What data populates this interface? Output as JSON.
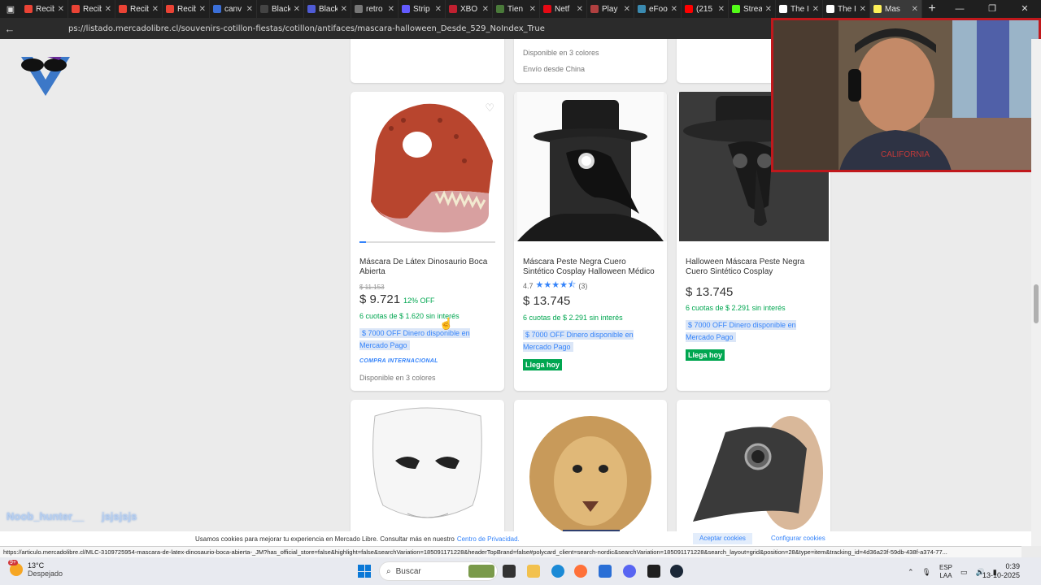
{
  "browser": {
    "tabs": [
      {
        "label": "Recib",
        "color": "#ea4335"
      },
      {
        "label": "Recib",
        "color": "#ea4335"
      },
      {
        "label": "Recib",
        "color": "#ea4335"
      },
      {
        "label": "Recib",
        "color": "#ea4335"
      },
      {
        "label": "canv",
        "color": "#3b6fd8"
      },
      {
        "label": "Black",
        "color": "#444444"
      },
      {
        "label": "Black",
        "color": "#4f5bd5"
      },
      {
        "label": "retro",
        "color": "#777777"
      },
      {
        "label": "Strip",
        "color": "#635bff"
      },
      {
        "label": "XBO",
        "color": "#c02030"
      },
      {
        "label": "Tien",
        "color": "#4a7a3a"
      },
      {
        "label": "Netf",
        "color": "#e50914"
      },
      {
        "label": "Play",
        "color": "#b04040"
      },
      {
        "label": "eFoo",
        "color": "#3a8ab0"
      },
      {
        "label": "(215",
        "color": "#ff0000"
      },
      {
        "label": "Strea",
        "color": "#53fc18"
      },
      {
        "label": "The I",
        "color": "#ffffff"
      },
      {
        "label": "The I",
        "color": "#ffffff"
      },
      {
        "label": "Mas",
        "color": "#fff159"
      }
    ],
    "url": "ps://listado.mercadolibre.cl/souvenirs-cotillon-fiestas/cotillon/antifaces/mascara-halloween_Desde_529_NoIndex_True"
  },
  "top_cards": {
    "middle": {
      "colors": "Disponible en 3 colores",
      "shipping": "Envío desde China"
    }
  },
  "products": [
    {
      "title": "Máscara De Látex Dinosaurio Boca Abierta",
      "old_price": "$ 11.153",
      "price": "$ 9.721",
      "discount": "12% OFF",
      "installments": "6 cuotas de $ 1.620 sin interés",
      "promo": "$ 7000 OFF Dinero disponible en Mercado Pago",
      "intl": "COMPRA INTERNACIONAL",
      "colors": "Disponible en 3 colores"
    },
    {
      "title": "Máscara Peste Negra Cuero Sintético Cosplay Halloween Médico",
      "rating": "4.7",
      "reviews": "(3)",
      "stars": 4.5,
      "price": "$ 13.745",
      "installments": "6 cuotas de $ 2.291 sin interés",
      "promo": "$ 7000 OFF Dinero disponible en Mercado Pago",
      "delivery": "Llega hoy"
    },
    {
      "title": "Halloween Máscara Peste Negra Cuero Sintético Cosplay",
      "price": "$ 13.745",
      "installments": "6 cuotas de $ 2.291 sin interés",
      "promo": "$ 7000 OFF Dinero disponible en Mercado Pago",
      "delivery": "Llega hoy"
    }
  ],
  "overlay": {
    "name": "Noob_hunter__",
    "extra": "jsjsjsjs"
  },
  "cookie": {
    "text": "Usamos cookies para mejorar tu experiencia en Mercado Libre. Consultar más en nuestro",
    "link": "Centro de Privacidad.",
    "accept": "Aceptar cookies",
    "config": "Configurar cookies"
  },
  "status_url": "https://articulo.mercadolibre.cl/MLC-3109725954-mascara-de-latex-dinosaurio-boca-abierta-_JM?has_official_store=false&highlight=false&searchVariation=185091171228&headerTopBrand=false#polycard_client=search-nordic&searchVariation=185091171228&search_layout=grid&position=28&type=item&tracking_id=4d36a23f-59db-438f-a374-77...",
  "taskbar": {
    "weather_temp": "13°C",
    "weather_desc": "Despejado",
    "weather_badge": "9+",
    "search_placeholder": "Buscar",
    "lang_top": "ESP",
    "lang_bottom": "LAA",
    "time": "0:39",
    "date": "13-10-2025"
  }
}
